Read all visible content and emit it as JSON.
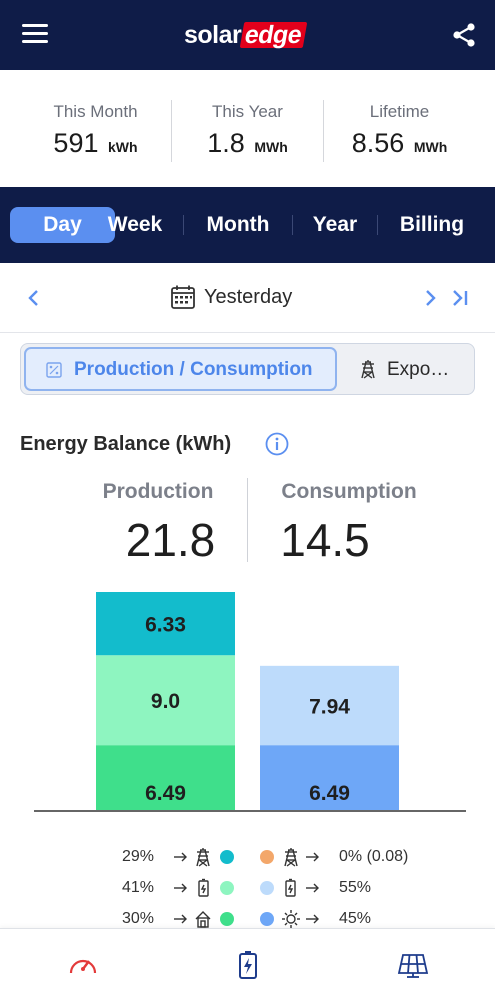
{
  "header": {
    "logo_left": "solar",
    "logo_right": "edge",
    "menu_icon": "hamburger-menu-icon",
    "share_icon": "share-icon"
  },
  "summary": [
    {
      "label": "This Month",
      "value": "591",
      "unit": "kWh"
    },
    {
      "label": "This Year",
      "value": "1.8",
      "unit": "MWh"
    },
    {
      "label": "Lifetime",
      "value": "8.56",
      "unit": "MWh"
    }
  ],
  "periods": [
    {
      "label": "Day",
      "active": true
    },
    {
      "label": "Week",
      "active": false
    },
    {
      "label": "Month",
      "active": false
    },
    {
      "label": "Year",
      "active": false
    },
    {
      "label": "Billing",
      "active": false
    }
  ],
  "date_nav": {
    "label": "Yesterday"
  },
  "view_toggle": {
    "option1": "Production / Consumption",
    "option2": "Expo…"
  },
  "energy_balance": {
    "title": "Energy Balance (kWh)",
    "production_label": "Production",
    "production_value": "21.8",
    "consumption_label": "Consumption",
    "consumption_value": "14.5"
  },
  "colors": {
    "nav_bg": "#0f1c48",
    "accent": "#5b8ff0",
    "export": "#13bccc",
    "battery_charge": "#8ef5c0",
    "self_consumption": "#3fdf8b",
    "import": "#f3a76a",
    "battery_discharge": "#bddbfb",
    "solar_direct": "#6ea7f7"
  },
  "chart_data": {
    "type": "bar",
    "categories": [
      "Production",
      "Consumption"
    ],
    "series": [
      {
        "values": [
          6.49,
          6.49
        ],
        "labels": [
          "6.49",
          "6.49"
        ],
        "colors": [
          "#3fdf8b",
          "#6ea7f7"
        ]
      },
      {
        "values": [
          9.0,
          7.94
        ],
        "labels": [
          "9.0",
          "7.94"
        ],
        "colors": [
          "#8ef5c0",
          "#bddbfb"
        ]
      },
      {
        "values": [
          6.33,
          0
        ],
        "labels": [
          "6.33",
          ""
        ],
        "colors": [
          "#13bccc",
          "#bddbfb"
        ]
      }
    ],
    "ylim": [
      0,
      21.82
    ]
  },
  "legend": [
    {
      "left_pct": "29%",
      "right_pct": "0% (0.08)",
      "left_color": "#13bccc",
      "right_color": "#f3a76a",
      "left_icon": "grid-tower-icon",
      "right_icon": "grid-tower-icon"
    },
    {
      "left_pct": "41%",
      "right_pct": "55%",
      "left_color": "#8ef5c0",
      "right_color": "#bddbfb",
      "left_icon": "battery-icon",
      "right_icon": "battery-icon"
    },
    {
      "left_pct": "30%",
      "right_pct": "45%",
      "left_color": "#3fdf8b",
      "right_color": "#6ea7f7",
      "left_icon": "house-icon",
      "right_icon": "sun-icon"
    }
  ],
  "bottom_nav": [
    {
      "icon": "dashboard-gauge-icon",
      "color": "#e33a3a"
    },
    {
      "icon": "battery-charging-icon",
      "color": "#1e3c8c"
    },
    {
      "icon": "solar-panel-icon",
      "color": "#1e3c8c"
    }
  ]
}
